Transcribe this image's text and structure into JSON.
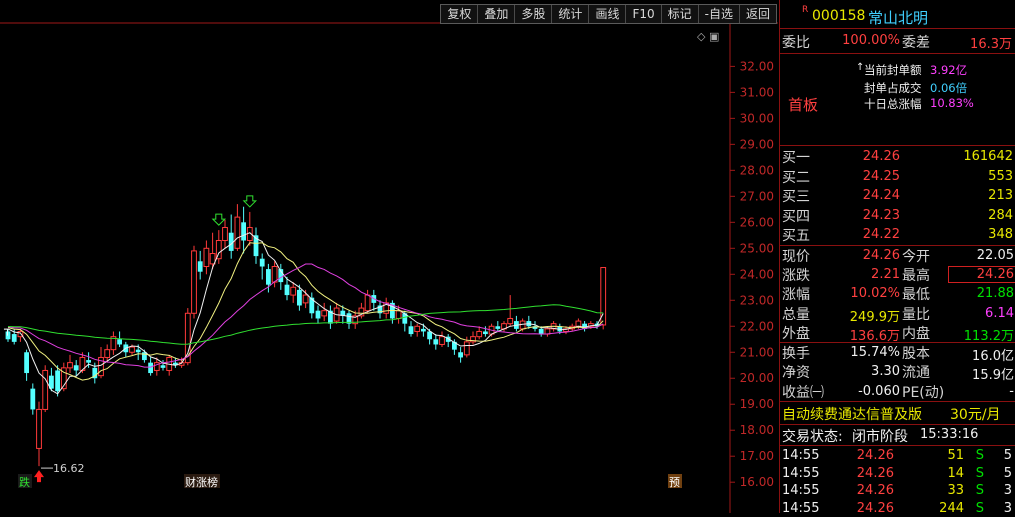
{
  "toolbar": {
    "items": [
      "复权",
      "叠加",
      "多股",
      "统计",
      "画线",
      "F10",
      "标记",
      "-自选",
      "返回"
    ]
  },
  "stock": {
    "marker": "R",
    "code": "000158",
    "name": "常山北明"
  },
  "order_ratio": {
    "label_ratio": "委比",
    "ratio": "100.00%",
    "label_diff": "委差",
    "diff": "16.3万"
  },
  "seal_info": {
    "arrow": "↑",
    "amount_label": "当前封单额",
    "amount": "3.92亿",
    "ratio_label": "封单占成交",
    "ratio": "0.06倍",
    "gain_label": "十日总涨幅",
    "gain": "10.83%",
    "board": "首板"
  },
  "bids": [
    {
      "label": "买一",
      "price": "24.26",
      "volume": "161642"
    },
    {
      "label": "买二",
      "price": "24.25",
      "volume": "553"
    },
    {
      "label": "买三",
      "price": "24.24",
      "volume": "213"
    },
    {
      "label": "买四",
      "price": "24.23",
      "volume": "284"
    },
    {
      "label": "买五",
      "price": "24.22",
      "volume": "348"
    }
  ],
  "quote": [
    {
      "l1": "现价",
      "v1": "24.26",
      "c1": "red",
      "l2": "今开",
      "v2": "22.05",
      "c2": "wht"
    },
    {
      "l1": "涨跌",
      "v1": "2.21",
      "c1": "red",
      "l2": "最高",
      "v2": "24.26",
      "c2": "red"
    },
    {
      "l1": "涨幅",
      "v1": "10.02%",
      "c1": "red",
      "l2": "最低",
      "v2": "21.88",
      "c2": "grn"
    },
    {
      "l1": "总量",
      "v1": "249.9万",
      "c1": "yel",
      "l2": "量比",
      "v2": "6.14",
      "c2": "mag"
    },
    {
      "l1": "外盘",
      "v1": "136.6万",
      "c1": "red",
      "l2": "内盘",
      "v2": "113.2万",
      "c2": "grn"
    }
  ],
  "fundamentals": [
    {
      "l1": "换手",
      "v1": "15.74%",
      "l2": "股本",
      "v2": "16.0亿"
    },
    {
      "l1": "净资",
      "v1": "3.30",
      "l2": "流通",
      "v2": "15.9亿"
    },
    {
      "l1": "收益㈠",
      "v1": "-0.060",
      "l2": "PE(动)",
      "v2": "-"
    }
  ],
  "ad": {
    "text": "自动续费通达信普及版",
    "price": "30元/月"
  },
  "status": {
    "label": "交易状态:",
    "value": "闭市阶段",
    "time": "15:33:16"
  },
  "ticks": [
    {
      "time": "14:55",
      "price": "24.26",
      "vol": "51",
      "side": "S",
      "n": "5"
    },
    {
      "time": "14:55",
      "price": "24.26",
      "vol": "14",
      "side": "S",
      "n": "5"
    },
    {
      "time": "14:55",
      "price": "24.26",
      "vol": "33",
      "side": "S",
      "n": "3"
    },
    {
      "time": "14:55",
      "price": "24.26",
      "vol": "244",
      "side": "S",
      "n": "3"
    }
  ],
  "chart_labels": {
    "low_marker": "16.62",
    "tag_drop": "跌",
    "tag_rank": "财涨榜",
    "tag_pre": "预"
  },
  "chart_data": {
    "type": "candlestick",
    "y_ticks": [
      "32.00",
      "31.00",
      "30.00",
      "29.00",
      "28.00",
      "27.00",
      "26.00",
      "25.00",
      "24.00",
      "23.00",
      "22.00",
      "21.00",
      "20.00",
      "19.00",
      "18.00",
      "17.00",
      "16.00"
    ],
    "ylim": [
      15.7,
      33.4
    ],
    "low_price": 16.62,
    "candles": [
      [
        21.8,
        21.5,
        21.9,
        21.4
      ],
      [
        21.7,
        21.4,
        21.9,
        21.3
      ],
      [
        21.6,
        21.8,
        21.9,
        21.4
      ],
      [
        21.0,
        20.2,
        21.1,
        19.9
      ],
      [
        19.6,
        18.8,
        19.8,
        18.6
      ],
      [
        17.3,
        18.8,
        19.1,
        16.62
      ],
      [
        18.8,
        20.3,
        20.5,
        18.7
      ],
      [
        20.1,
        19.6,
        20.4,
        19.5
      ],
      [
        20.3,
        19.5,
        20.5,
        19.3
      ],
      [
        19.6,
        20.4,
        20.6,
        19.5
      ],
      [
        20.4,
        20.6,
        20.9,
        20.2
      ],
      [
        20.5,
        20.3,
        20.7,
        20.1
      ],
      [
        20.3,
        20.8,
        21.0,
        20.2
      ],
      [
        20.7,
        20.6,
        21.0,
        20.4
      ],
      [
        20.4,
        20.0,
        20.6,
        19.8
      ],
      [
        20.1,
        20.8,
        21.2,
        20.0
      ],
      [
        20.8,
        21.1,
        21.3,
        20.6
      ],
      [
        21.1,
        21.6,
        21.8,
        20.9
      ],
      [
        21.5,
        21.3,
        21.8,
        21.2
      ],
      [
        21.3,
        21.0,
        21.4,
        20.8
      ],
      [
        21.0,
        21.2,
        21.3,
        20.9
      ],
      [
        21.1,
        21.0,
        21.3,
        20.7
      ],
      [
        21.0,
        20.7,
        21.1,
        20.6
      ],
      [
        20.6,
        20.2,
        20.8,
        20.1
      ],
      [
        20.3,
        20.6,
        20.8,
        20.1
      ],
      [
        20.5,
        20.4,
        20.7,
        20.3
      ],
      [
        20.3,
        20.8,
        20.9,
        20.1
      ],
      [
        20.6,
        20.5,
        20.8,
        20.4
      ],
      [
        20.5,
        20.6,
        20.8,
        20.4
      ],
      [
        20.6,
        22.5,
        22.7,
        20.5
      ],
      [
        22.5,
        24.9,
        25.1,
        22.3
      ],
      [
        24.5,
        24.1,
        24.9,
        23.8
      ],
      [
        24.3,
        25.0,
        25.3,
        24.0
      ],
      [
        24.4,
        24.8,
        25.6,
        24.2
      ],
      [
        24.6,
        25.3,
        25.7,
        24.4
      ],
      [
        25.3,
        25.8,
        26.1,
        25.0
      ],
      [
        25.6,
        24.9,
        26.3,
        24.6
      ],
      [
        25.0,
        26.2,
        26.7,
        24.9
      ],
      [
        26.0,
        25.3,
        26.6,
        24.8
      ],
      [
        25.3,
        25.8,
        26.4,
        25.1
      ],
      [
        25.5,
        24.7,
        25.8,
        24.4
      ],
      [
        24.6,
        24.3,
        24.8,
        23.8
      ],
      [
        24.2,
        23.6,
        24.4,
        23.3
      ],
      [
        23.7,
        24.3,
        24.5,
        23.5
      ],
      [
        24.2,
        23.7,
        24.4,
        23.4
      ],
      [
        23.6,
        23.2,
        23.9,
        23.0
      ],
      [
        23.2,
        23.5,
        23.7,
        22.9
      ],
      [
        23.4,
        22.8,
        23.6,
        22.6
      ],
      [
        22.9,
        23.2,
        23.4,
        22.7
      ],
      [
        23.1,
        22.5,
        23.3,
        22.3
      ],
      [
        22.6,
        22.3,
        22.8,
        22.1
      ],
      [
        22.4,
        22.6,
        22.9,
        22.2
      ],
      [
        22.6,
        22.1,
        22.8,
        21.9
      ],
      [
        22.2,
        22.7,
        22.9,
        22.1
      ],
      [
        22.6,
        22.4,
        22.8,
        22.1
      ],
      [
        22.5,
        22.1,
        22.6,
        21.9
      ],
      [
        22.1,
        22.4,
        22.6,
        21.9
      ],
      [
        22.4,
        22.7,
        22.9,
        22.3
      ],
      [
        22.6,
        23.2,
        23.4,
        22.5
      ],
      [
        23.2,
        22.9,
        23.4,
        22.6
      ],
      [
        22.8,
        22.5,
        23.0,
        22.3
      ],
      [
        22.5,
        22.9,
        23.1,
        22.3
      ],
      [
        22.9,
        22.3,
        23.0,
        22.1
      ],
      [
        22.3,
        22.6,
        22.8,
        22.1
      ],
      [
        22.5,
        22.1,
        22.6,
        21.8
      ],
      [
        22.0,
        21.7,
        22.2,
        21.6
      ],
      [
        21.8,
        22.0,
        22.1,
        21.6
      ],
      [
        21.9,
        21.8,
        22.1,
        21.6
      ],
      [
        21.8,
        21.5,
        21.9,
        21.3
      ],
      [
        21.5,
        21.3,
        21.7,
        21.1
      ],
      [
        21.3,
        21.6,
        21.8,
        21.2
      ],
      [
        21.6,
        21.4,
        21.7,
        21.2
      ],
      [
        21.4,
        21.1,
        21.5,
        20.9
      ],
      [
        21.0,
        20.8,
        21.2,
        20.6
      ],
      [
        20.9,
        21.4,
        21.6,
        20.8
      ],
      [
        21.4,
        21.6,
        21.8,
        21.3
      ],
      [
        21.6,
        21.8,
        22.0,
        21.5
      ],
      [
        21.8,
        21.7,
        22.0,
        21.6
      ],
      [
        21.7,
        22.0,
        22.1,
        21.6
      ],
      [
        22.0,
        21.9,
        22.2,
        21.8
      ],
      [
        21.9,
        22.1,
        22.2,
        21.8
      ],
      [
        22.1,
        22.3,
        23.2,
        22.0
      ],
      [
        22.2,
        21.9,
        22.4,
        21.8
      ],
      [
        21.9,
        22.2,
        22.3,
        21.8
      ],
      [
        22.2,
        22.0,
        22.4,
        21.9
      ],
      [
        22.0,
        21.9,
        22.2,
        21.8
      ],
      [
        21.9,
        21.7,
        22.0,
        21.6
      ],
      [
        21.7,
        21.9,
        22.0,
        21.6
      ],
      [
        21.9,
        22.1,
        22.2,
        21.8
      ],
      [
        22.0,
        21.8,
        22.1,
        21.7
      ],
      [
        21.8,
        21.9,
        22.0,
        21.7
      ],
      [
        21.9,
        22.0,
        22.1,
        21.8
      ],
      [
        22.0,
        22.2,
        22.3,
        21.9
      ],
      [
        22.1,
        21.9,
        22.2,
        21.8
      ],
      [
        22.0,
        22.1,
        22.2,
        21.9
      ],
      [
        22.1,
        22.0,
        22.2,
        21.9
      ],
      [
        22.05,
        24.26,
        24.26,
        21.88
      ]
    ]
  }
}
